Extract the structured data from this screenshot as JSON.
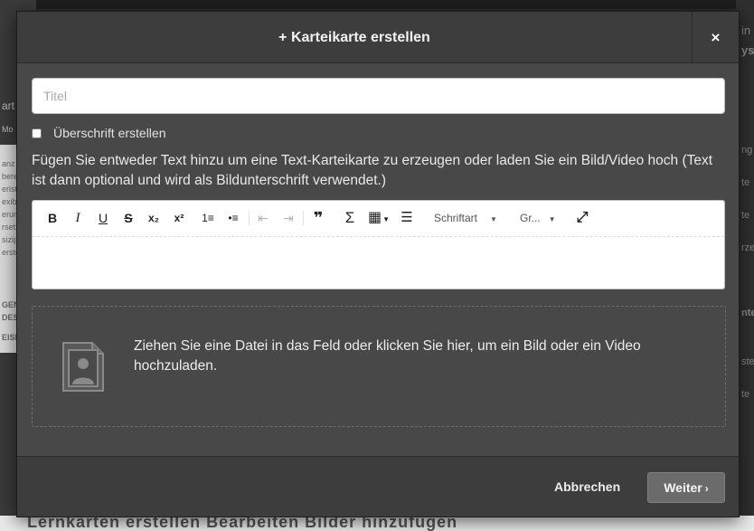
{
  "modal": {
    "title": "+ Karteikarte erstellen",
    "close_label": "×",
    "title_input": {
      "placeholder": "Titel",
      "value": ""
    },
    "heading_checkbox": {
      "label": "Überschrift erstellen",
      "checked": false
    },
    "instruction": "Fügen Sie entweder Text hinzu um eine Text-Karteikarte zu erzeugen oder laden Sie ein Bild/Video hoch (Text ist dann optional und wird als Bildunterschrift verwendet.)",
    "editor": {
      "toolbar": {
        "bold": "B",
        "italic": "I",
        "underline": "U",
        "strikethrough": "S",
        "subscript": "x₂",
        "superscript": "x²",
        "ordered_list": "1≡",
        "bullet_list": "•≡",
        "outdent": "⇤",
        "indent": "⇥",
        "blockquote": "❞",
        "formula": "Σ",
        "table": "▦",
        "horizontal_rule": "☰",
        "font_select": "Schriftart",
        "size_select": "Gr...",
        "fullscreen": "⤢",
        "caret": "▼"
      },
      "content": ""
    },
    "dropzone": {
      "text": "Ziehen Sie eine Datei in das Feld oder klicken Sie hier, um ein Bild oder ein Video hochzuladen.",
      "icon": "image-placeholder-icon"
    },
    "footer": {
      "cancel_label": "Abbrechen",
      "next_label": "Weiter",
      "next_chevron": "›"
    }
  },
  "background": {
    "right_snippets": [
      "in",
      "ys",
      "ng",
      "te",
      "te",
      "rze",
      "nte",
      "ste",
      "te",
      "te"
    ],
    "left_snippets": [
      "art",
      "Mo",
      "anz",
      "bere",
      "erist",
      "exib",
      "erun",
      "rsetz",
      "sizip",
      "erste",
      "GEN",
      "DES",
      "EISE"
    ],
    "bottom_text": "Lernkarten erstellen Bearbeiten Bilder hinzufügen"
  },
  "colors": {
    "modal_bg": "#484848",
    "header_bg": "#3d3d3d",
    "primary_button": "#6b6b6b",
    "text_light": "#f2f2f2"
  }
}
